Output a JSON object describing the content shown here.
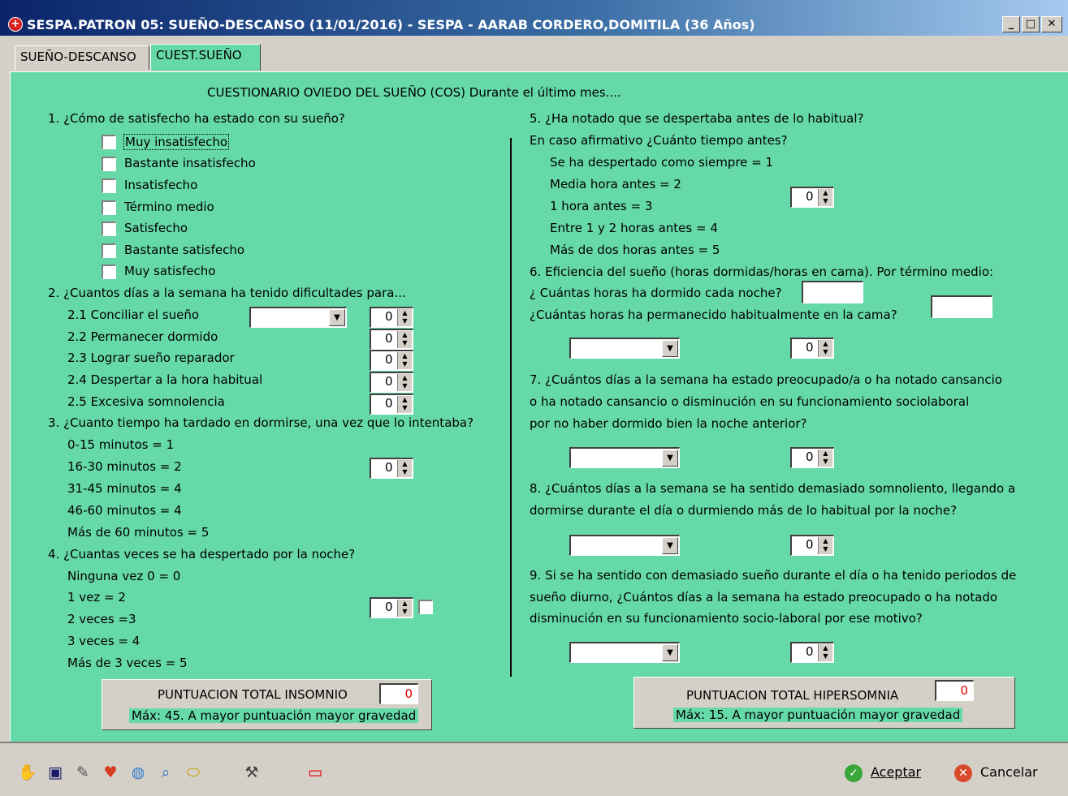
{
  "window": {
    "title": "SESPA.PATRON 05: SUEÑO-DESCANSO (11/01/2016) - SESPA - AARAB CORDERO,DOMITILA (36 Años)"
  },
  "tabs": [
    {
      "label": "SUEÑO-DESCANSO"
    },
    {
      "label": "CUEST.SUEÑO"
    }
  ],
  "header": "CUESTIONARIO OVIEDO DEL SUEÑO (COS)  Durante el último mes....",
  "q1": {
    "title": "1. ¿Cómo de satisfecho ha estado con su sueño?",
    "options": [
      "Muy insatisfecho",
      "Bastante insatisfecho",
      "Insatisfecho",
      "Término medio",
      "Satisfecho",
      "Bastante satisfecho",
      "Muy satisfecho"
    ]
  },
  "q2": {
    "title": "2. ¿Cuantos días a la semana ha tenido dificultades para...",
    "items": [
      {
        "label": "2.1 Conciliar el sueño",
        "value": "0"
      },
      {
        "label": "2.2 Permanecer dormido",
        "value": "0"
      },
      {
        "label": "2.3 Lograr sueño reparador",
        "value": "0"
      },
      {
        "label": "2.4 Despertar a la hora habitual",
        "value": "0"
      },
      {
        "label": "2.5 Excesiva somnolencia",
        "value": "0"
      }
    ]
  },
  "q3": {
    "title": "3. ¿Cuanto tiempo ha tardado en dormirse, una vez que lo intentaba?",
    "options": [
      "0-15 minutos = 1",
      "16-30 minutos = 2",
      "31-45 minutos = 4",
      "46-60 minutos = 4",
      "Más de 60 minutos = 5"
    ],
    "value": "0"
  },
  "q4": {
    "title": "4. ¿Cuantas veces se ha despertado por la noche?",
    "options": [
      "Ninguna vez 0 = 0",
      "1 vez = 2",
      "2 veces =3",
      "3 veces = 4",
      "Más de 3 veces = 5"
    ],
    "value": "0"
  },
  "q5": {
    "title": "5. ¿Ha notado que se despertaba antes de lo habitual?",
    "subtitle": "En caso afirmativo ¿Cuánto tiempo antes?",
    "options": [
      "Se ha despertado como siempre = 1",
      "Media hora antes = 2",
      "1 hora antes = 3",
      "Entre 1 y 2 horas antes = 4",
      "Más de dos horas antes = 5"
    ],
    "value": "0"
  },
  "q6": {
    "title": "6. Eficiencia del sueño (horas dormidas/horas en cama). Por término medio:",
    "line1": "¿ Cuántas horas ha dormido cada noche?",
    "line2": "¿Cuántas horas ha permanecido habitualmente en la cama?",
    "value": "0"
  },
  "q7": {
    "lines": [
      "7. ¿Cuántos días a la semana ha estado preocupado/a o ha notado cansancio",
      "o ha notado cansancio o disminución en su funcionamiento sociolaboral",
      "por no haber dormido bien la noche anterior?"
    ],
    "value": "0"
  },
  "q8": {
    "lines": [
      "8. ¿Cuántos días a la semana se ha sentido demasiado somnoliento, llegando a",
      "dormirse durante el día o durmiendo más de lo habitual por la noche?"
    ],
    "value": "0"
  },
  "q9": {
    "lines": [
      "9. Si se ha sentido con demasiado sueño durante el día o ha tenido periodos de",
      "sueño diurno, ¿Cuántos días a la semana ha estado preocupado o ha notado",
      "disminución en su funcionamiento socio-laboral por ese motivo?"
    ],
    "value": "0"
  },
  "insomnio": {
    "label": "PUNTUACION TOTAL INSOMNIO",
    "value": "0",
    "note": "Máx: 45. A mayor puntuación mayor gravedad"
  },
  "hipersomnia": {
    "label": "PUNTUACION TOTAL HIPERSOMNIA",
    "value": "0",
    "note": "Máx: 15. A mayor puntuación mayor gravedad"
  },
  "footer": {
    "accept": "Aceptar",
    "cancel": "Cancelar"
  }
}
